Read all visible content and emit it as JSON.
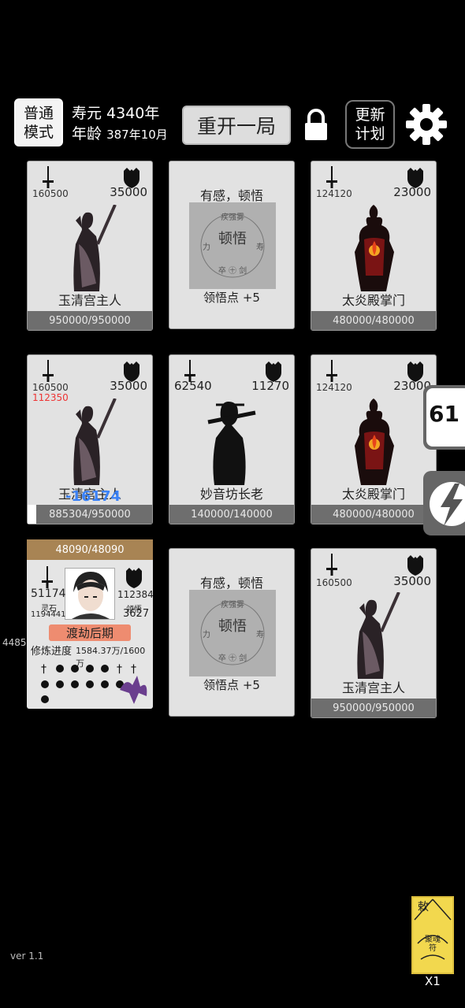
{
  "header": {
    "mode_line1": "普通",
    "mode_line2": "模式",
    "lifespan_label": "寿元 4340年",
    "age_label": "年龄",
    "age_value": "387年10月",
    "restart_label": "重开一局",
    "plan_line1": "更新",
    "plan_line2": "计划"
  },
  "cards": [
    {
      "type": "enemy",
      "attack": "160500",
      "defense": "35000",
      "name": "玉清宫主人",
      "hp": "950000/950000",
      "figure": "cultivator"
    },
    {
      "type": "event",
      "title": "有感，顿悟",
      "reward": "领悟点 +5"
    },
    {
      "type": "enemy",
      "attack": "124120",
      "defense": "23000",
      "name": "太炎殿掌门",
      "hp": "480000/480000",
      "figure": "flame-demon"
    },
    {
      "type": "enemy",
      "attack": "160500",
      "attack_reduced": "112350",
      "defense": "35000",
      "name": "玉清宫主人",
      "hp": "885304/950000",
      "hp_fraction": 0.932,
      "damage_float": "-16174",
      "figure": "cultivator"
    },
    {
      "type": "enemy",
      "attack": "62540",
      "defense": "11270",
      "name": "妙音坊长老",
      "hp": "140000/140000",
      "figure": "flute-elder"
    },
    {
      "type": "enemy",
      "attack": "124120",
      "defense": "23000",
      "name": "太炎殿掌门",
      "hp": "480000/480000",
      "figure": "flame-demon"
    },
    {
      "type": "event",
      "title": "有感，顿悟",
      "reward": "领悟点 +5"
    },
    {
      "type": "enemy",
      "attack": "160500",
      "defense": "35000",
      "name": "玉清宫主人",
      "hp": "950000/950000",
      "figure": "cultivator"
    }
  ],
  "player": {
    "hp": "48090/48090",
    "attack": "51174",
    "spirit_stone_label": "灵石",
    "spirit_stone": "1194441",
    "defense": "112384",
    "insight_label": "领悟",
    "insight": "3627",
    "realm": "渡劫后期",
    "progress_label": "修炼进度",
    "progress_value": "1584.37万/1600万",
    "side_number": "4485"
  },
  "side": {
    "counter": "61"
  },
  "footer": {
    "version": "ver 1.1",
    "talisman_count": "X1",
    "talisman_text": "聚魂符"
  },
  "colors": {
    "bg": "#000000",
    "card": "#e2e2e2",
    "hpbar": "#6e6e6e",
    "realm": "#ee8c70",
    "player_top": "#a88454",
    "talisman": "#f2d84e"
  }
}
